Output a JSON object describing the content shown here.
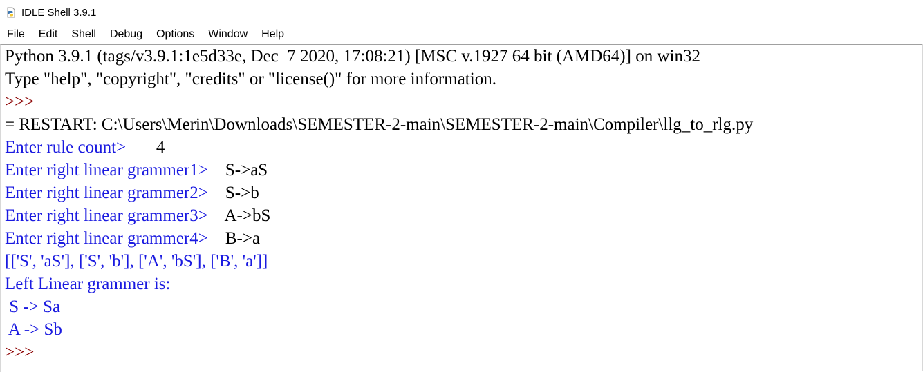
{
  "window": {
    "title": "IDLE Shell 3.9.1",
    "icon": "python-icon"
  },
  "menu": [
    "File",
    "Edit",
    "Shell",
    "Debug",
    "Options",
    "Window",
    "Help"
  ],
  "shell": {
    "banner1": "Python 3.9.1 (tags/v3.9.1:1e5d33e, Dec  7 2020, 17:08:21) [MSC v.1927 64 bit (AMD64)] on win32",
    "banner2": "Type \"help\", \"copyright\", \"credits\" or \"license()\" for more information.",
    "prompt1": ">>> ",
    "restart": "= RESTART: C:\\Users\\Merin\\Downloads\\SEMESTER-2-main\\SEMESTER-2-main\\Compiler\\llg_to_rlg.py",
    "inputs": [
      {
        "prompt": "Enter rule count>",
        "gap": "       ",
        "value": "4"
      },
      {
        "prompt": "Enter right linear grammer1>",
        "gap": "    ",
        "value": "S->aS"
      },
      {
        "prompt": "Enter right linear grammer2>",
        "gap": "    ",
        "value": "S->b"
      },
      {
        "prompt": "Enter right linear grammer3>",
        "gap": "    ",
        "value": "A->bS"
      },
      {
        "prompt": "Enter right linear grammer4>",
        "gap": "    ",
        "value": "B->a"
      }
    ],
    "list_output": "[['S', 'aS'], ['S', 'b'], ['A', 'bS'], ['B', 'a']]",
    "result_header": "Left Linear grammer is:",
    "results": [
      " S -> Sa",
      " A -> Sb"
    ],
    "prompt2": ">>> "
  },
  "colors": {
    "stdout": "#1a1ae0",
    "prompt": "#8b0000",
    "stdin": "#000000"
  }
}
